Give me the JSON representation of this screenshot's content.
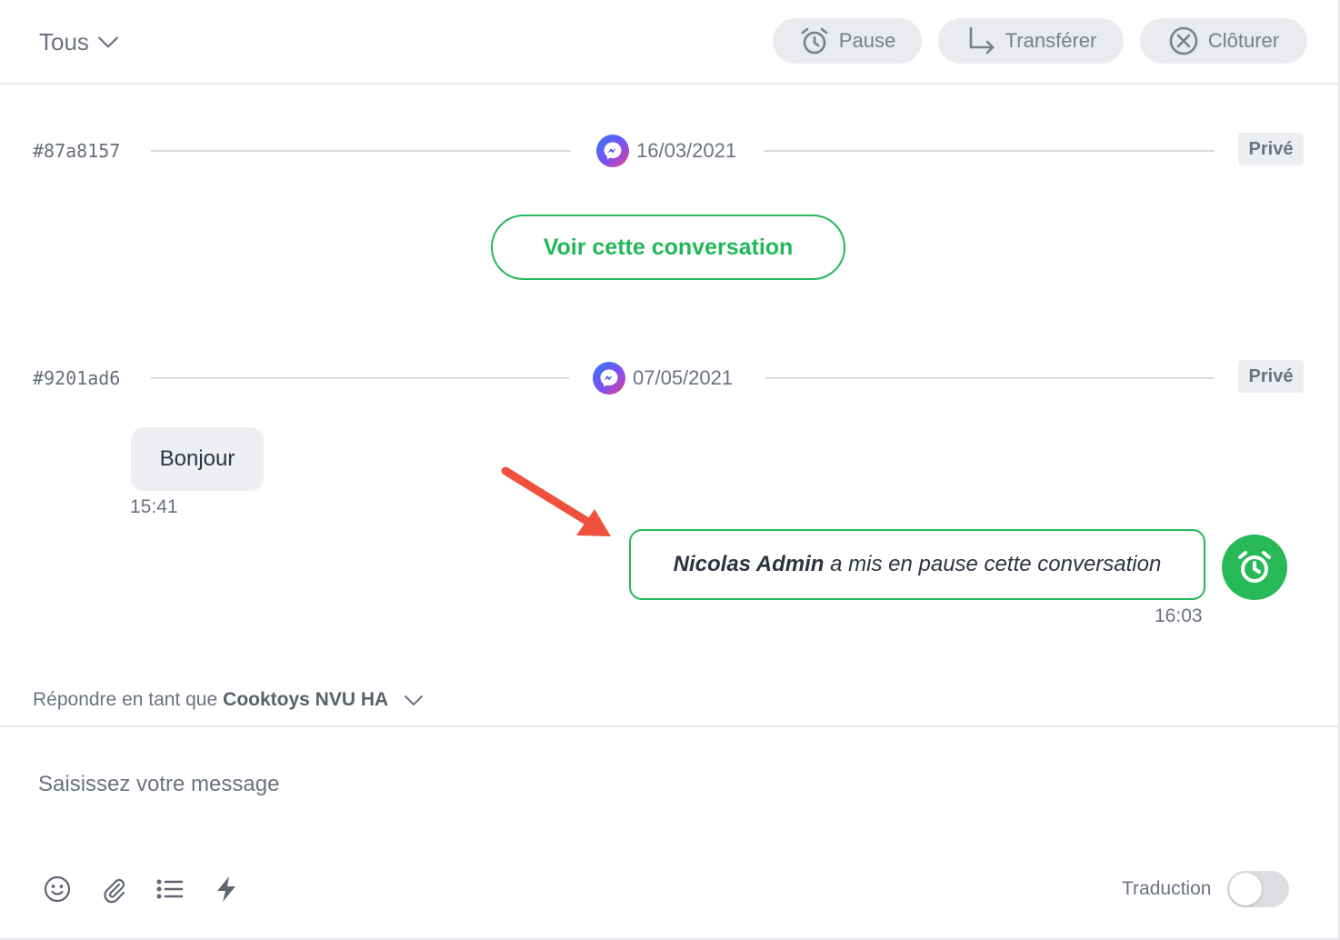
{
  "header": {
    "filter_label": "Tous",
    "actions": {
      "pause": "Pause",
      "transfer": "Transférer",
      "close": "Clôturer"
    }
  },
  "conversations": [
    {
      "id": "#87a8157",
      "channel_icon": "messenger-icon",
      "date": "16/03/2021",
      "visibility": "Privé",
      "view_button": "Voir cette conversation"
    },
    {
      "id": "#9201ad6",
      "channel_icon": "messenger-icon",
      "date": "07/05/2021",
      "visibility": "Privé",
      "messages": [
        {
          "direction": "incoming",
          "text": "Bonjour",
          "time": "15:41"
        },
        {
          "direction": "event",
          "actor": "Nicolas Admin",
          "text": "a mis en pause cette conversation",
          "time": "16:03",
          "icon": "alarm-clock-icon"
        }
      ]
    }
  ],
  "reply": {
    "prefix": "Répondre en tant que",
    "account": "Cooktoys NVU HA"
  },
  "composer": {
    "placeholder": "Saisissez votre message",
    "tools": [
      "emoji-icon",
      "paperclip-icon",
      "list-icon",
      "lightning-icon"
    ],
    "translation_label": "Traduction",
    "translation_enabled": false
  },
  "colors": {
    "accent_green": "#22b85a",
    "annotation_arrow": "#f0513e",
    "button_bg": "#e9ebee"
  }
}
